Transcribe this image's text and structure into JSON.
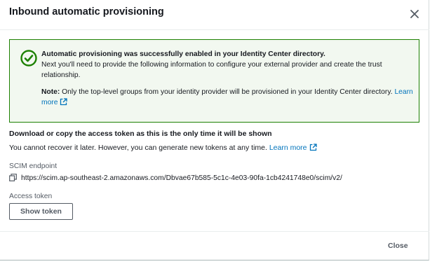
{
  "modal": {
    "title": "Inbound automatic provisioning",
    "close_icon": "close-icon"
  },
  "flash": {
    "status_icon": "success-check-circle-icon",
    "status_color": "#1d8102",
    "heading": "Automatic provisioning was successfully enabled in your Identity Center directory.",
    "message": "Next you'll need to provide the following information to configure your external provider and create the trust relationship.",
    "note_label": "Note:",
    "note_text": " Only the top-level groups from your identity provider will be provisioned in your Identity Center directory. ",
    "learn_more": "Learn more",
    "learn_more_icon": "external-link-icon"
  },
  "token_section": {
    "heading": "Download or copy the access token as this is the only time it will be shown",
    "subtext": "You cannot recover it later. However, you can generate new tokens at any time. ",
    "learn_more": "Learn more",
    "learn_more_icon": "external-link-icon"
  },
  "scim": {
    "label": "SCIM endpoint",
    "copy_icon": "copy-icon",
    "url": "https://scim.ap-southeast-2.amazonaws.com/Dbvae67b585-5c1c-4e03-90fa-1cb4241748e0/scim/v2/"
  },
  "access_token": {
    "label": "Access token",
    "button_label": "Show token"
  },
  "footer": {
    "close_label": "Close"
  },
  "colors": {
    "link": "#0073bb",
    "success": "#1d8102",
    "flash_bg": "#f2f8f0"
  }
}
